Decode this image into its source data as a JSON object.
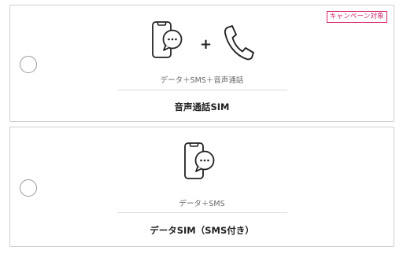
{
  "plans": [
    {
      "badge": "キャンペーン対象",
      "icons": [
        "smartphone-chat-icon",
        "phone-handset-icon"
      ],
      "plus": "+",
      "features": "データ＋SMS＋音声通話",
      "name": "音声通話SIM",
      "selected": false
    },
    {
      "icons": [
        "smartphone-chat-icon"
      ],
      "features": "データ＋SMS",
      "name": "データSIM（SMS付き）",
      "selected": false
    }
  ],
  "colors": {
    "badge": "#d6246e",
    "border": "#cfcfcf",
    "icon": "#222222"
  }
}
